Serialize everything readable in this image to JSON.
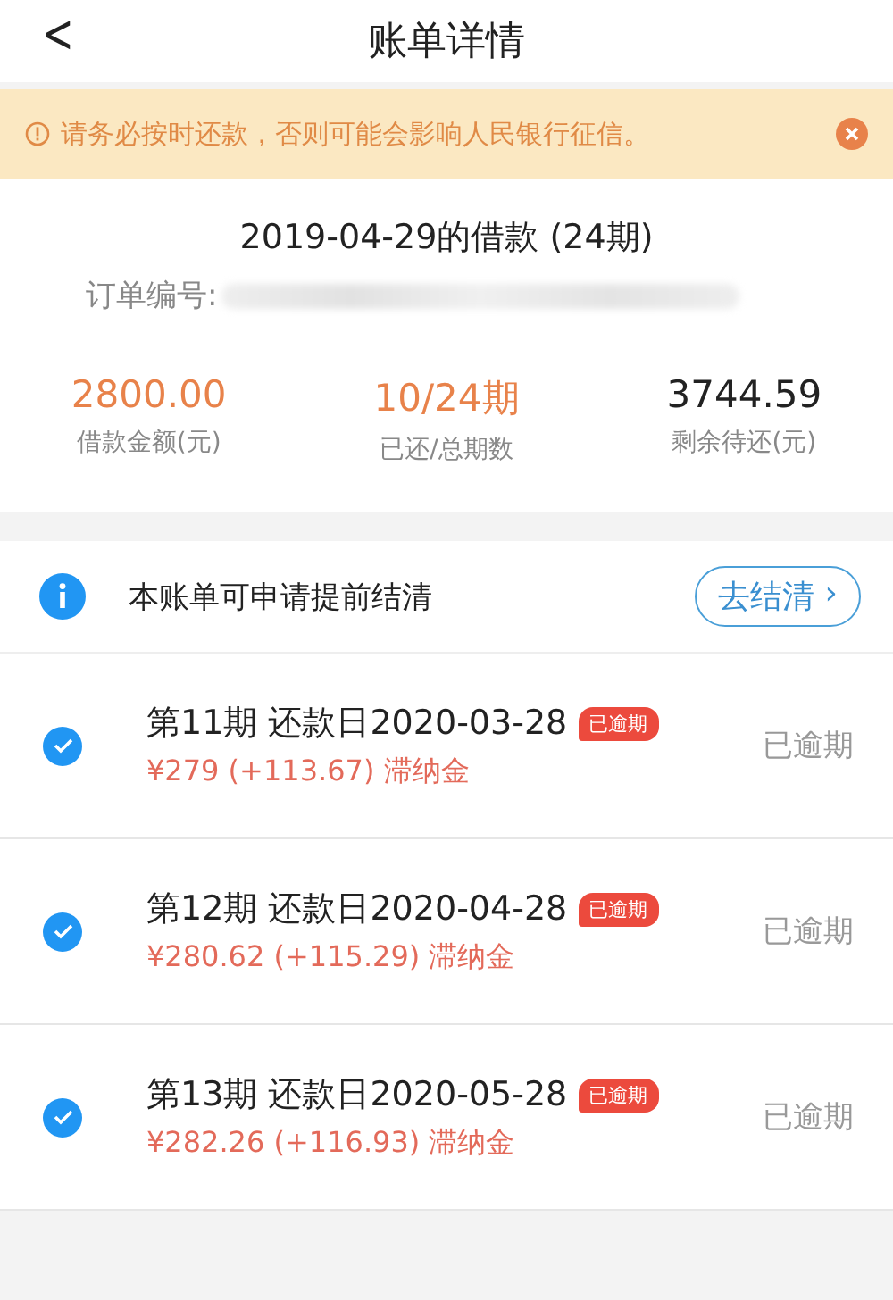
{
  "header": {
    "back": "<",
    "title": "账单详情"
  },
  "alert": {
    "text": "请务必按时还款，否则可能会影响人民银行征信。",
    "dismissible": true
  },
  "loan": {
    "title": "2019-04-29的借款 (24期)",
    "order_label": "订单编号:",
    "stats": [
      {
        "value": "2800.00",
        "label": "借款金额(元)",
        "color": "#e8824a"
      },
      {
        "value": "10/24期",
        "label": "已还/总期数",
        "color": "#e8824a"
      },
      {
        "value": "3744.59",
        "label": "剩余待还(元)",
        "color": "#222222"
      }
    ]
  },
  "settle": {
    "text": "本账单可申请提前结清",
    "button": "去结清",
    "chevron": "›"
  },
  "installments": [
    {
      "title": "第11期 还款日2020-03-28",
      "badge": "已逾期",
      "amount": "¥279 (+113.67) 滞纳金",
      "status": "已逾期",
      "checked": true
    },
    {
      "title": "第12期 还款日2020-04-28",
      "badge": "已逾期",
      "amount": "¥280.62 (+115.29) 滞纳金",
      "status": "已逾期",
      "checked": true
    },
    {
      "title": "第13期 还款日2020-05-28",
      "badge": "已逾期",
      "amount": "¥282.26 (+116.93) 滞纳金",
      "status": "已逾期",
      "checked": true
    }
  ]
}
